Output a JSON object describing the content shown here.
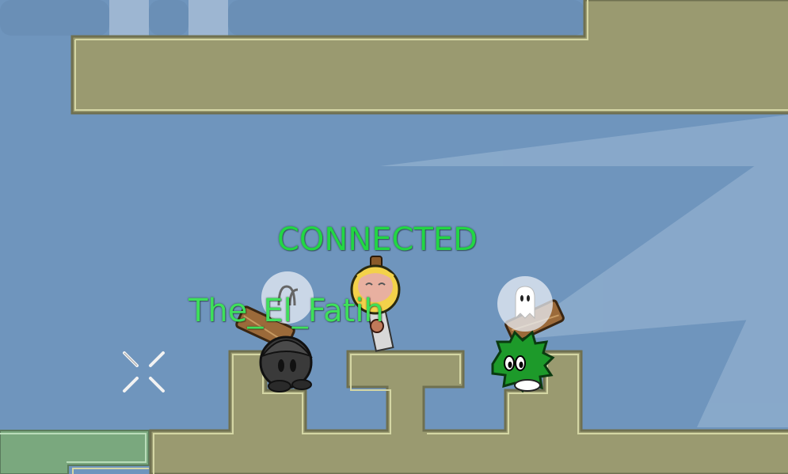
{
  "hud": {
    "status_text": "CONNECTED",
    "player_name": "The_El_Fatih"
  },
  "colors": {
    "sky": "#6f95bd",
    "sky_dark": "#6a8fb6",
    "sky_light": "#9db6d2",
    "ground_fill": "#9a9a70",
    "ground_outline": "#d4d6a4",
    "ground_edge": "#6f7050",
    "freeze_tile": "#7aa87e",
    "name_green": "#3ee05a",
    "status_green": "#22d644"
  },
  "icons": {
    "crosshair": "crosshair-icon",
    "ghost_emote": "ghost-emote-icon",
    "glasses_emote": "glasses-emote-icon"
  }
}
